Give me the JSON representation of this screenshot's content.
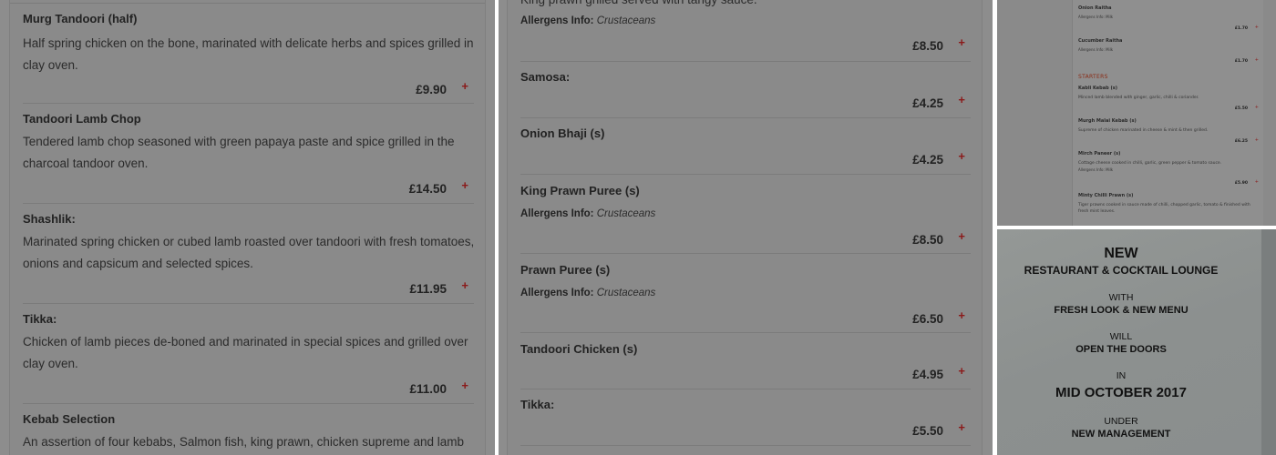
{
  "panel1": {
    "items": [
      {
        "name": "Murg Tandoori (half)",
        "desc": "Half spring chicken on the bone, marinated with delicate herbs and spices grilled in clay oven.",
        "price": "£9.90"
      },
      {
        "name": "Tandoori Lamb Chop",
        "desc": "Tendered lamb chop seasoned with green papaya paste and spice grilled in the charcoal tandoor oven.",
        "price": "£14.50"
      },
      {
        "name": "Shashlik:",
        "desc": "Marinated spring chicken or cubed lamb roasted over tandoori with fresh tomatoes, onions and capsicum and selected spices.",
        "price": "£11.95"
      },
      {
        "name": "Tikka:",
        "desc": "Chicken of lamb pieces de-boned and marinated in special spices and grilled over clay oven.",
        "price": "£11.00"
      },
      {
        "name": "Kebab Selection",
        "desc": "An assertion of four kebabs, Salmon fish, king prawn, chicken supreme and lamb",
        "price": ""
      }
    ],
    "plus_symbol": "+"
  },
  "panel2": {
    "top_desc": "King prawn grilled served with tangy sauce.",
    "allergens_label": "Allergens Info:",
    "top_allergen": "Crustaceans",
    "top_price": "£8.50",
    "items": [
      {
        "name": "Samosa:",
        "price": "£4.25",
        "allergen": ""
      },
      {
        "name": "Onion Bhaji (s)",
        "price": "£4.25",
        "allergen": ""
      },
      {
        "name": "King Prawn Puree (s)",
        "price": "£8.50",
        "allergen": "Crustaceans"
      },
      {
        "name": "Prawn Puree (s)",
        "price": "£6.50",
        "allergen": "Crustaceans"
      },
      {
        "name": "Tandoori Chicken (s)",
        "price": "£4.95",
        "allergen": ""
      },
      {
        "name": "Tikka:",
        "price": "£5.50",
        "allergen": ""
      }
    ]
  },
  "panel3": {
    "rows": [
      {
        "title": "Onion Raitha",
        "allergen": "Allergens Info: Milk",
        "price": "£1.70"
      },
      {
        "title": "Cucumber Raitha",
        "allergen": "Allergens Info: Milk",
        "price": "£1.70"
      }
    ],
    "section": "STARTERS",
    "starters": [
      {
        "title": "Kabli Kebab (s)",
        "desc": "Minced lamb blended with ginger, garlic, chilli & coriander.",
        "allergen": "",
        "price": "£5.50"
      },
      {
        "title": "Murgh Malai Kebab (s)",
        "desc": "Supreme of chicken marinated in cheese & mint & then grilled.",
        "allergen": "",
        "price": "£6.25"
      },
      {
        "title": "Mirch Paneer (s)",
        "desc": "Cottage cheese cooked in chilli, garlic, green pepper & tomato sauce.",
        "allergen": "Allergens Info: Milk",
        "price": "£5.90"
      },
      {
        "title": "Minty Chilli Prawn (s)",
        "desc": "Tiger prawns cooked in sauce made of chilli, chopped garlic, tomato & finished with fresh mint leaves.",
        "allergen": "",
        "price": ""
      }
    ]
  },
  "panel4": {
    "line1": "NEW",
    "line2": "RESTAURANT & COCKTAIL LOUNGE",
    "line3": "WITH",
    "line4": "FRESH LOOK & NEW MENU",
    "line5": "WILL",
    "line6": "OPEN THE DOORS",
    "line7": "IN",
    "line8": "MID OCTOBER 2017",
    "line9": "UNDER",
    "line10": "NEW MANAGEMENT"
  }
}
